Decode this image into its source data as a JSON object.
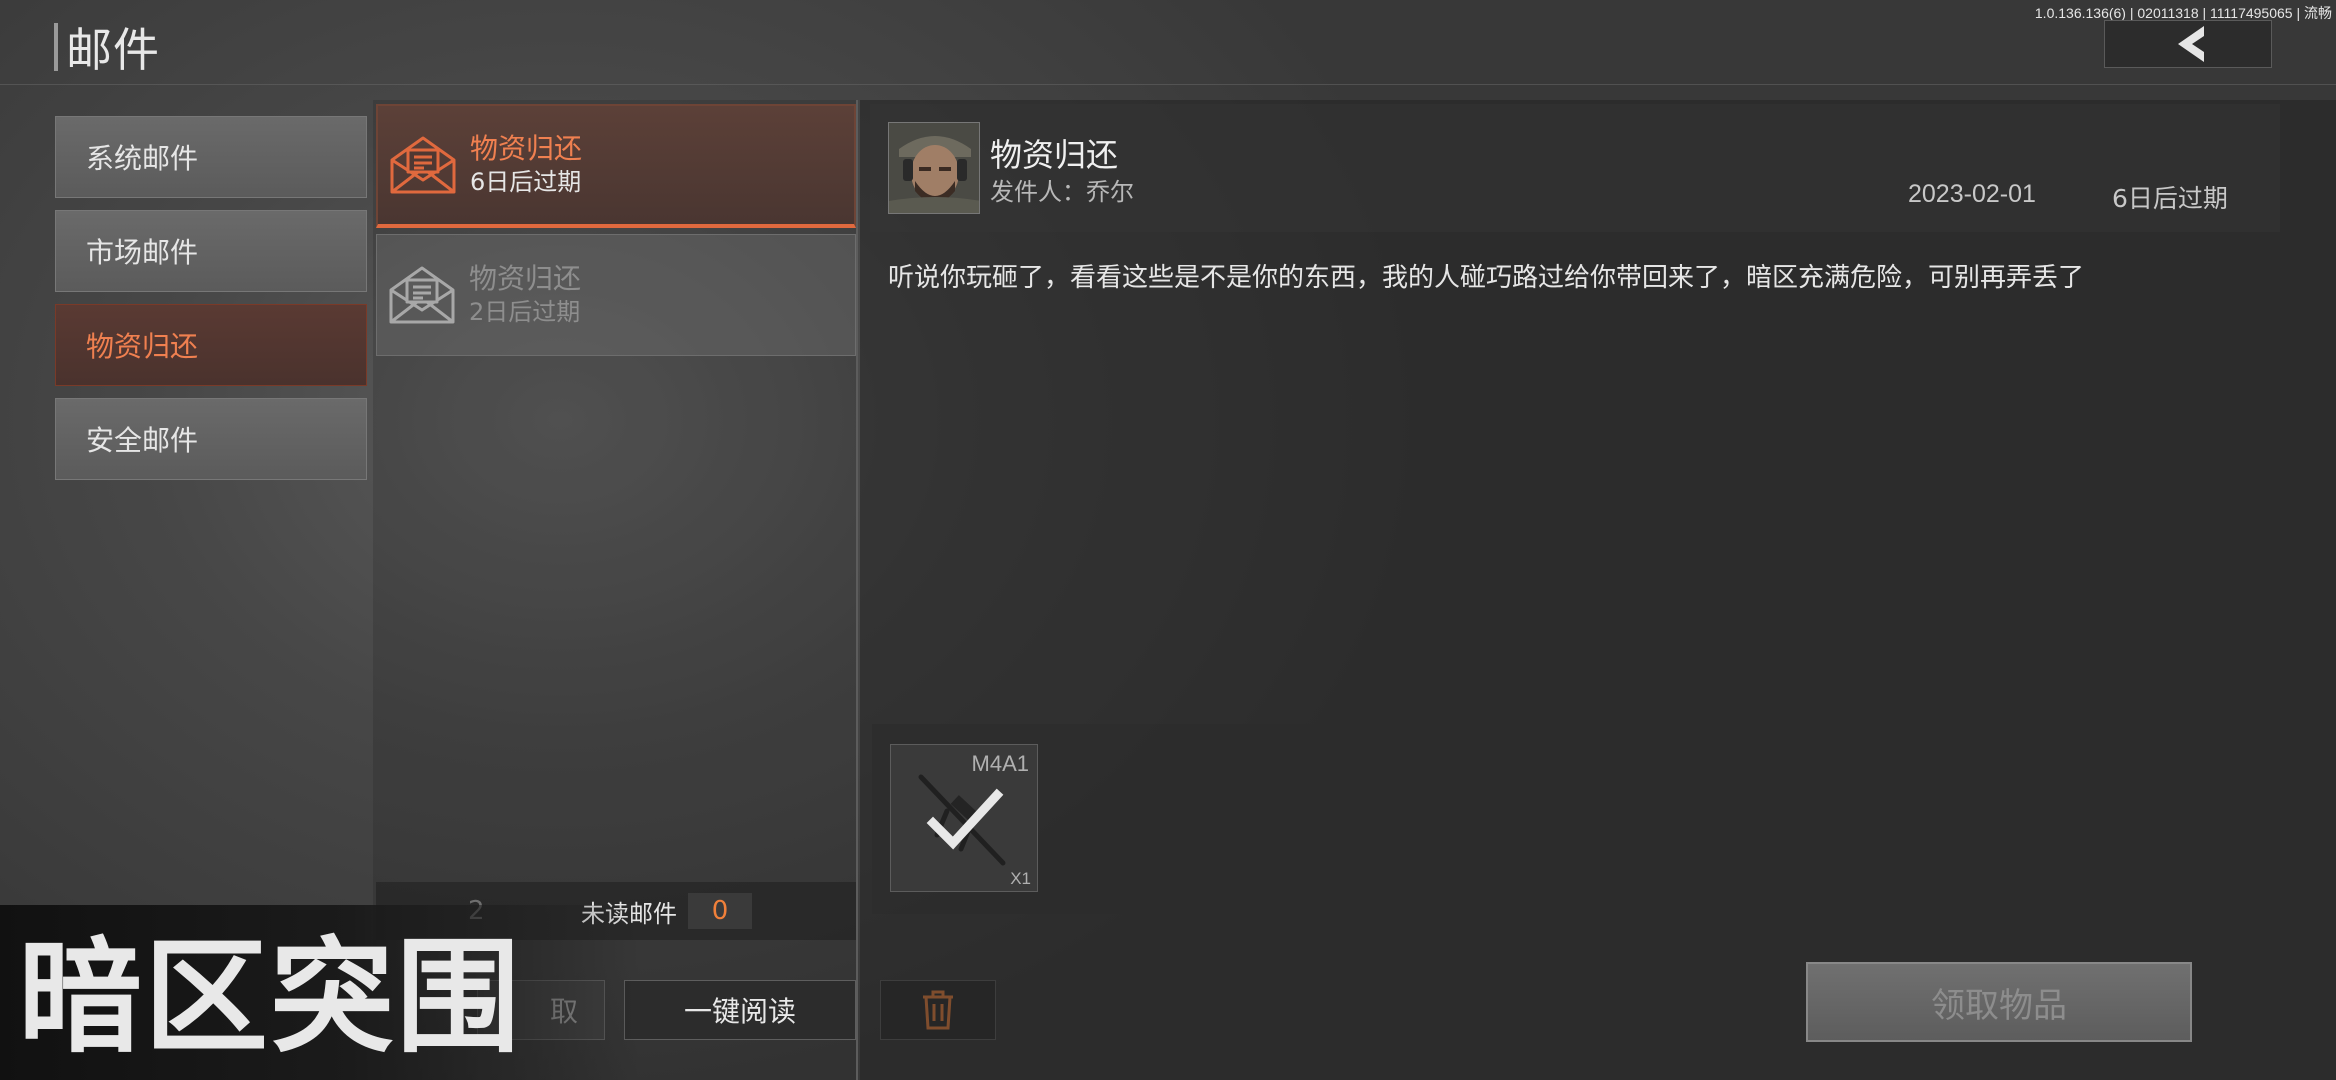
{
  "header": {
    "title": "邮件",
    "version": "1.0.136.136(6) | 02011318 | 11117495065 | 流畅"
  },
  "categories": [
    {
      "label": "系统邮件",
      "active": false
    },
    {
      "label": "市场邮件",
      "active": false
    },
    {
      "label": "物资归还",
      "active": true
    },
    {
      "label": "安全邮件",
      "active": false
    }
  ],
  "mails": [
    {
      "title": "物资归还",
      "expiry": "6日后过期"
    },
    {
      "title": "物资归还",
      "expiry": "2日后过期"
    }
  ],
  "list_footer": {
    "count": "2",
    "unread_label": "未读邮件",
    "unread_count": "0",
    "claim_all_label": "取",
    "read_all_label": "一键阅读"
  },
  "detail": {
    "title": "物资归还",
    "sender_label": "发件人：",
    "sender": "乔尔",
    "date": "2023-02-01",
    "expiry": "6日后过期",
    "body": "听说你玩砸了，看看这些是不是你的东西，我的人碰巧路过给你带回来了，暗区充满危险，可别再弄丢了",
    "attachment": {
      "name": "M4A1",
      "qty": "X1",
      "claimed": true
    },
    "claim_label": "领取物品"
  },
  "logo_text": "暗区突围",
  "colors": {
    "accent": "#e0693e",
    "accent_text": "#f08050",
    "unread_count": "#f0803a"
  }
}
